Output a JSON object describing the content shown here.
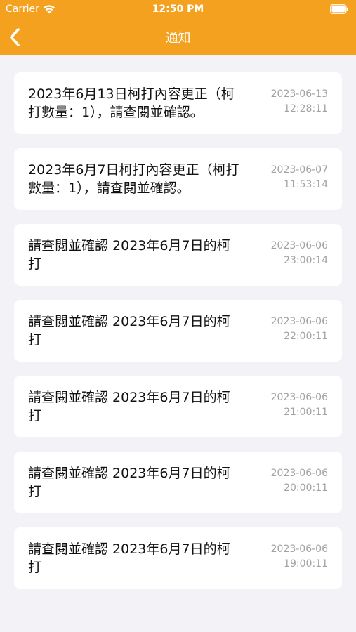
{
  "status_bar": {
    "carrier": "Carrier",
    "time": "12:50 PM"
  },
  "nav": {
    "title": "通知",
    "back_icon": "chevron-left-icon"
  },
  "colors": {
    "header": "#f4a11f",
    "background": "#f2f2f7",
    "card": "#ffffff",
    "timestamp": "#a2a2a2"
  },
  "notifications": [
    {
      "message": "2023年6月13日柯打內容更正（柯打數量：1），請查閱並確認。",
      "date": "2023-06-13",
      "time": "12:28:11"
    },
    {
      "message": "2023年6月7日柯打內容更正（柯打數量：1），請查閱並確認。",
      "date": "2023-06-07",
      "time": "11:53:14"
    },
    {
      "message": "請查閱並確認 2023年6月7日的柯打",
      "date": "2023-06-06",
      "time": "23:00:14"
    },
    {
      "message": "請查閱並確認 2023年6月7日的柯打",
      "date": "2023-06-06",
      "time": "22:00:11"
    },
    {
      "message": "請查閱並確認 2023年6月7日的柯打",
      "date": "2023-06-06",
      "time": "21:00:11"
    },
    {
      "message": "請查閱並確認 2023年6月7日的柯打",
      "date": "2023-06-06",
      "time": "20:00:11"
    },
    {
      "message": "請查閱並確認 2023年6月7日的柯打",
      "date": "2023-06-06",
      "time": "19:00:11"
    }
  ]
}
